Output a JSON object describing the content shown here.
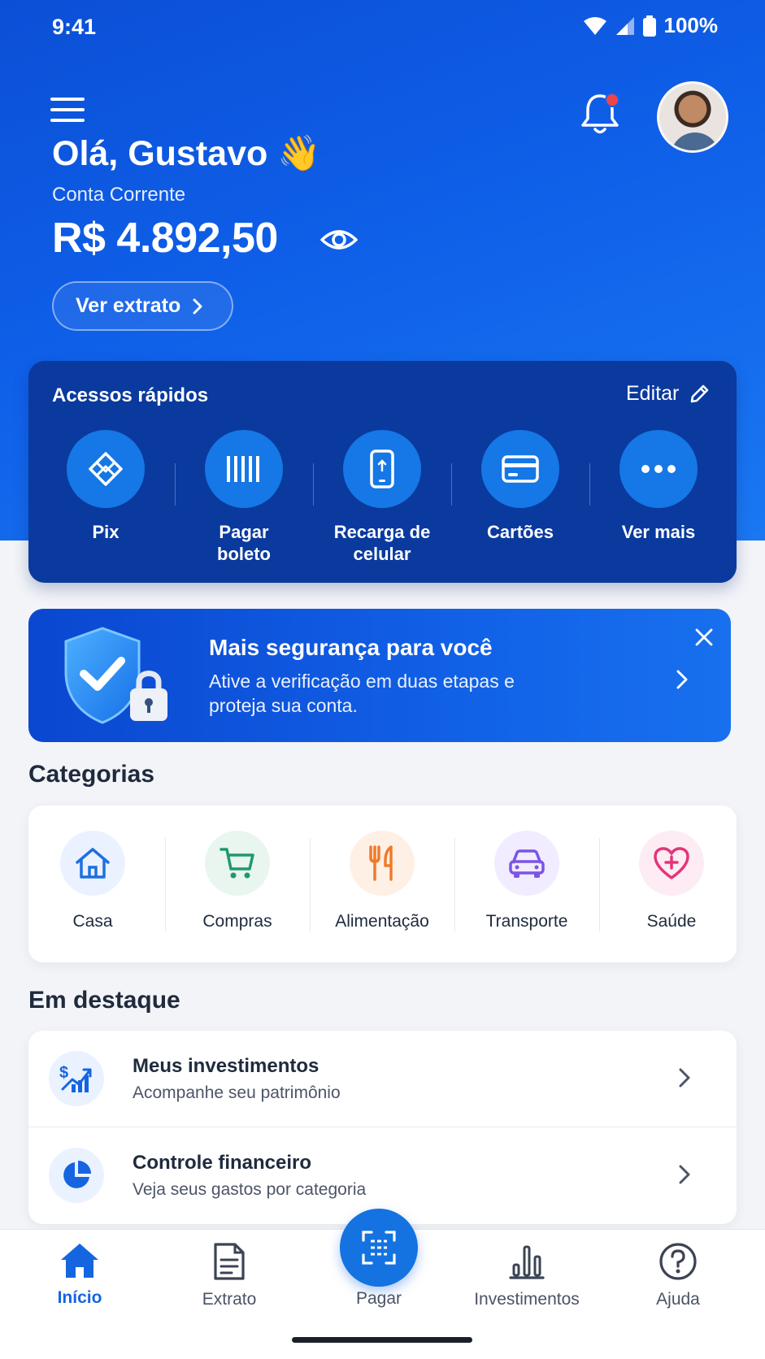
{
  "status_bar": {
    "time": "9:41",
    "battery": "100%"
  },
  "header": {
    "greeting": "Olá, Gustavo 👋",
    "account_type": "Conta Corrente",
    "balance": "R$ 4.892,50",
    "statement_button": "Ver extrato",
    "notifications_unread": true
  },
  "quick_access": {
    "title": "Acessos rápidos",
    "edit_label": "Editar",
    "items": [
      {
        "label": "Pix",
        "icon": "pix-icon"
      },
      {
        "label": "Pagar boleto",
        "icon": "barcode-icon"
      },
      {
        "label": "Recarga de celular",
        "icon": "phone-recharge-icon"
      },
      {
        "label": "Cartões",
        "icon": "card-icon"
      },
      {
        "label": "Ver mais",
        "icon": "more-icon"
      }
    ]
  },
  "security_banner": {
    "title": "Mais segurança para você",
    "text": "Ative a verificação em duas etapas e proteja sua conta."
  },
  "categories": {
    "title": "Categorias",
    "items": [
      {
        "label": "Casa",
        "icon": "house-icon",
        "color": "#1f6fe0",
        "bg": "#eaf2ff"
      },
      {
        "label": "Compras",
        "icon": "cart-icon",
        "color": "#1e9a6a",
        "bg": "#e8f6ef"
      },
      {
        "label": "Alimentação",
        "icon": "fork-knife-icon",
        "color": "#f07a2a",
        "bg": "#fff0e6"
      },
      {
        "label": "Transporte",
        "icon": "car-icon",
        "color": "#7b55e8",
        "bg": "#f1ecff"
      },
      {
        "label": "Saúde",
        "icon": "heart-plus-icon",
        "color": "#e4347a",
        "bg": "#fdecf3"
      }
    ]
  },
  "featured": {
    "title": "Em destaque",
    "items": [
      {
        "title": "Meus investimentos",
        "subtitle": "Acompanhe seu patrimônio",
        "icon": "investment-chart-icon"
      },
      {
        "title": "Controle financeiro",
        "subtitle": "Veja seus gastos por categoria",
        "icon": "pie-chart-icon"
      }
    ]
  },
  "bottom_nav": {
    "items": [
      {
        "label": "Início",
        "icon": "home-icon",
        "active": true
      },
      {
        "label": "Extrato",
        "icon": "document-icon",
        "active": false
      },
      {
        "label": "Pagar",
        "icon": "scan-icon",
        "active": false
      },
      {
        "label": "Investimentos",
        "icon": "bar-chart-icon",
        "active": false
      },
      {
        "label": "Ajuda",
        "icon": "help-icon",
        "active": false
      }
    ]
  },
  "colors": {
    "primary": "#1565e0",
    "hero_dark": "#0a3a9e",
    "accent_red": "#f0444a"
  }
}
